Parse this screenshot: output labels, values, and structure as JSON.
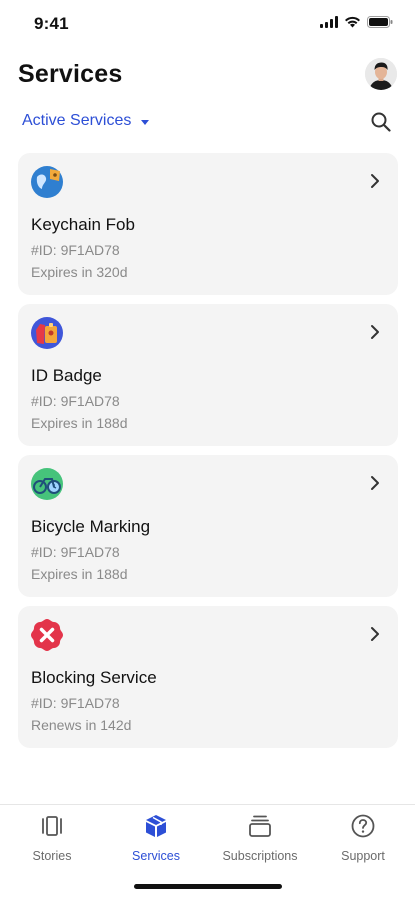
{
  "status_bar": {
    "time": "9:41",
    "icons": [
      "signal-icon",
      "wifi-icon",
      "battery-icon"
    ]
  },
  "header": {
    "title": "Services",
    "avatar_icon": "user-avatar"
  },
  "filter": {
    "label": "Active Services",
    "icon": "chevron-down-icon",
    "search_icon": "search-icon"
  },
  "colors": {
    "accent": "#2d4fd6",
    "card_bg": "#f4f4f4",
    "muted_text": "#8a8a8a"
  },
  "services": [
    {
      "title": "Keychain Fob",
      "id": "#ID: 9F1AD78",
      "status": "Expires in 320d",
      "icon": "keychain-fob-icon"
    },
    {
      "title": "ID Badge",
      "id": "#ID: 9F1AD78",
      "status": "Expires in 188d",
      "icon": "id-badge-icon"
    },
    {
      "title": "Bicycle Marking",
      "id": "#ID: 9F1AD78",
      "status": "Expires in 188d",
      "icon": "bicycle-icon"
    },
    {
      "title": "Blocking Service",
      "id": "#ID: 9F1AD78",
      "status": "Renews in 142d",
      "icon": "blocking-icon"
    }
  ],
  "tabs": [
    {
      "label": "Stories",
      "icon": "stories-icon",
      "active": false
    },
    {
      "label": "Services",
      "icon": "box-icon",
      "active": true
    },
    {
      "label": "Subscriptions",
      "icon": "stack-icon",
      "active": false
    },
    {
      "label": "Support",
      "icon": "help-icon",
      "active": false
    }
  ]
}
